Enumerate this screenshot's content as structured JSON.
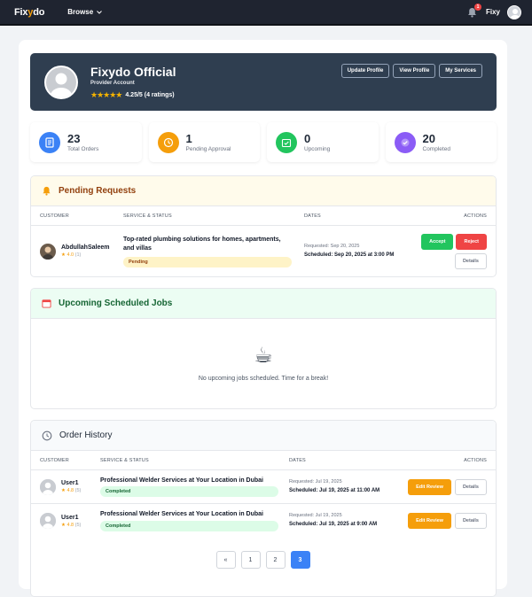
{
  "app": {
    "logo_a": "Fix",
    "logo_b": "y",
    "logo_c": "do",
    "browse": "Browse",
    "user": "Fixy",
    "notif_count": "1"
  },
  "profile": {
    "name": "Fixydo Official",
    "role": "Provider Account",
    "stars": "★★★★★",
    "rating": "4.25/5 (4 ratings)",
    "buttons": [
      "Update Profile",
      "View Profile",
      "My Services"
    ]
  },
  "stats": [
    {
      "num": "23",
      "label": "Total Orders",
      "color": "#3b82f6"
    },
    {
      "num": "1",
      "label": "Pending Approval",
      "color": "#f59e0b"
    },
    {
      "num": "0",
      "label": "Upcoming",
      "color": "#22c55e"
    },
    {
      "num": "20",
      "label": "Completed",
      "color": "#8b5cf6"
    }
  ],
  "pending": {
    "title": "Pending Requests",
    "cols": [
      "CUSTOMER",
      "SERVICE & STATUS",
      "DATES",
      "ACTIONS"
    ],
    "row": {
      "name": "AbdullahSaleem",
      "rating": "4.0",
      "count": "(1)",
      "service": "Top-rated plumbing solutions for homes, apartments, and villas",
      "status": "Pending",
      "requested": "Requested: Sep 20, 2025",
      "scheduled": "Scheduled: Sep 20, 2025 at 3:00 PM",
      "accept": "Accept",
      "reject": "Reject",
      "details": "Details"
    }
  },
  "upcoming": {
    "title": "Upcoming Scheduled Jobs",
    "empty_icon": "☕",
    "empty": "No upcoming jobs scheduled. Time for a break!"
  },
  "history": {
    "title": "Order History",
    "cols": [
      "CUSTOMER",
      "SERVICE & STATUS",
      "DATES",
      "ACTIONS"
    ],
    "rows": [
      {
        "name": "User1",
        "rating": "4.8",
        "count": "(5)",
        "service": "Professional Welder Services at Your Location in Dubai",
        "status": "Completed",
        "requested": "Requested: Jul 19, 2025",
        "scheduled": "Scheduled: Jul 19, 2025 at 11:00 AM",
        "review": "Edit Review",
        "details": "Details"
      },
      {
        "name": "User1",
        "rating": "4.8",
        "count": "(5)",
        "service": "Professional Welder Services at Your Location in Dubai",
        "status": "Completed",
        "requested": "Requested: Jul 19, 2025",
        "scheduled": "Scheduled: Jul 19, 2025 at 9:00 AM",
        "review": "Edit Review",
        "details": "Details"
      }
    ]
  },
  "pagination": [
    "«",
    "1",
    "2",
    "3"
  ]
}
